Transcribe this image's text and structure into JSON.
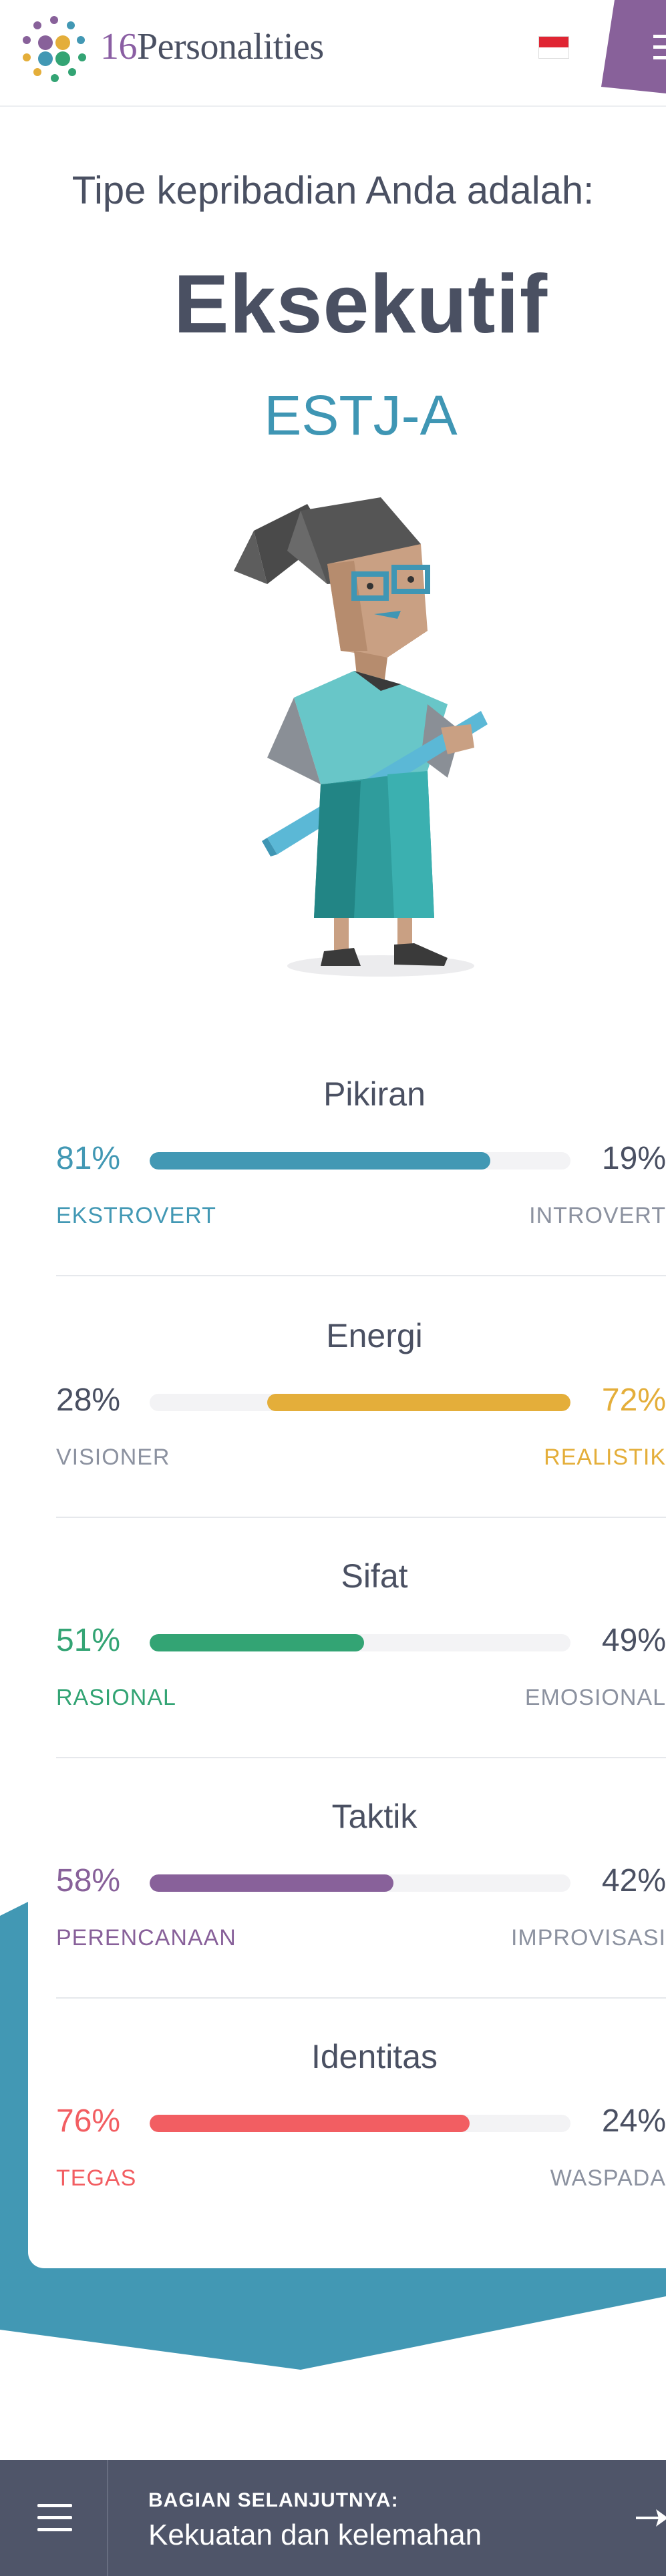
{
  "header": {
    "brand_num": "16",
    "brand_text": "Personalities"
  },
  "result": {
    "intro": "Tipe kepribadian Anda adalah:",
    "type_name": "Eksekutif",
    "type_code": "ESTJ-A"
  },
  "traits": [
    {
      "title": "Pikiran",
      "left_pct": "81%",
      "right_pct": "19%",
      "left_label": "EKSTROVERT",
      "right_label": "INTROVERT",
      "fill_from": "left",
      "fill_fraction": 0.81,
      "color": "#4298b4",
      "highlight": "left"
    },
    {
      "title": "Energi",
      "left_pct": "28%",
      "right_pct": "72%",
      "left_label": "VISIONER",
      "right_label": "REALISTIK",
      "fill_from": "right",
      "fill_fraction": 0.72,
      "color": "#e4ae3a",
      "highlight": "right"
    },
    {
      "title": "Sifat",
      "left_pct": "51%",
      "right_pct": "49%",
      "left_label": "RASIONAL",
      "right_label": "EMOSIONAL",
      "fill_from": "left",
      "fill_fraction": 0.51,
      "color": "#33a474",
      "highlight": "left"
    },
    {
      "title": "Taktik",
      "left_pct": "58%",
      "right_pct": "42%",
      "left_label": "PERENCANAAN",
      "right_label": "IMPROVISASI",
      "fill_from": "left",
      "fill_fraction": 0.58,
      "color": "#88619a",
      "highlight": "left"
    },
    {
      "title": "Identitas",
      "left_pct": "76%",
      "right_pct": "24%",
      "left_label": "TEGAS",
      "right_label": "WASPADA",
      "fill_from": "left",
      "fill_fraction": 0.76,
      "color": "#f25e62",
      "highlight": "left"
    }
  ],
  "bottom_nav": {
    "next_label": "BAGIAN SELANJUTNYA:",
    "next_title": "Kekuatan dan kelemahan"
  },
  "colors": {
    "text_dark": "#4a5062",
    "text_muted": "#8c92a0",
    "teal": "#4298b4",
    "purple": "#88619a",
    "nav_bg": "#4f5569"
  }
}
